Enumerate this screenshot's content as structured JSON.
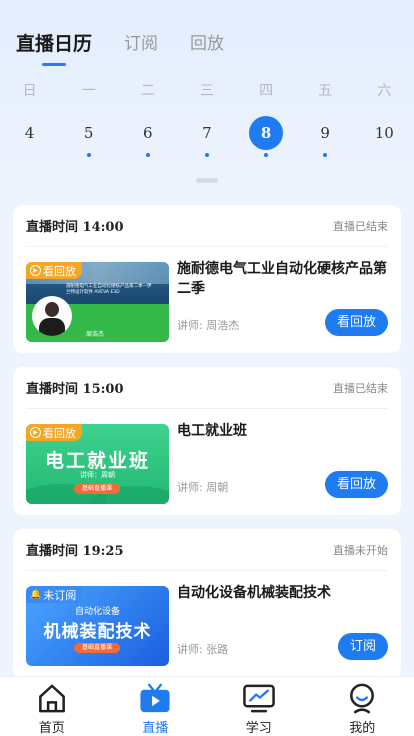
{
  "tabs": [
    "直播日历",
    "订阅",
    "回放"
  ],
  "calendar": {
    "weekdays": [
      "日",
      "一",
      "二",
      "三",
      "四",
      "五",
      "六"
    ],
    "days": [
      {
        "num": "4",
        "dot": false
      },
      {
        "num": "5",
        "dot": true
      },
      {
        "num": "6",
        "dot": true
      },
      {
        "num": "7",
        "dot": true
      },
      {
        "num": "8",
        "dot": true,
        "selected": true
      },
      {
        "num": "9",
        "dot": true
      },
      {
        "num": "10",
        "dot": false
      }
    ]
  },
  "sessions": [
    {
      "time": "直播时间 14:00",
      "status": "直播已结束",
      "badge": "看回放",
      "title": "施耐德电气工业自动化硬核产品第二季",
      "teacher": "讲师: 周浩杰",
      "button": "看回放",
      "thumb": {
        "line1": "施耐德电气工业自动化硬核产品第二季—伊",
        "line2": "兰特设计软件 AVEVA E3D",
        "name": "周浩杰"
      }
    },
    {
      "time": "直播时间 15:00",
      "status": "直播已结束",
      "badge": "看回放",
      "title": "电工就业班",
      "teacher": "讲师: 周朝",
      "button": "看回放",
      "thumb": {
        "main": "电工就业班",
        "sub": "讲师：周朝",
        "pill": "基础直播课"
      }
    },
    {
      "time": "直播时间 19:25",
      "status": "直播未开始",
      "badge": "未订阅",
      "title": "自动化设备机械装配技术",
      "teacher": "讲师: 张路",
      "button": "订阅",
      "thumb": {
        "top": "自动化设备",
        "main": "机械装配技术",
        "pill": "基础直播课"
      }
    }
  ],
  "nav": [
    {
      "label": "首页",
      "icon": "home-icon"
    },
    {
      "label": "直播",
      "icon": "tv-icon",
      "active": true
    },
    {
      "label": "学习",
      "icon": "monitor-chart-icon"
    },
    {
      "label": "我的",
      "icon": "person-icon"
    }
  ],
  "colors": {
    "accent": "#1f7bf0",
    "badge_orange": "#f5a623",
    "background": "#eef4fd"
  }
}
